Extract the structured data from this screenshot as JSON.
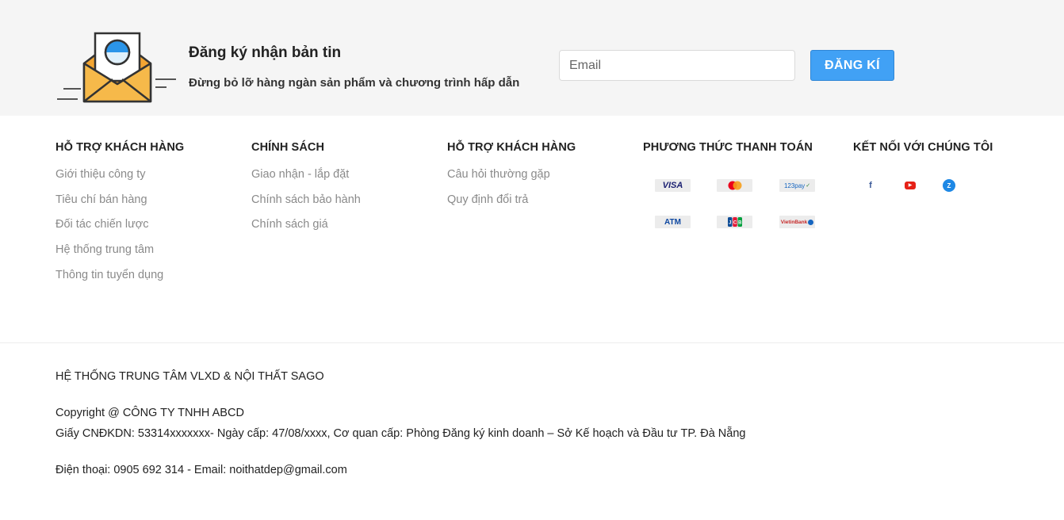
{
  "newsletter": {
    "illustration_icon": "envelope-newsletter-icon",
    "title": "Đăng ký nhận bản tin",
    "subtitle": "Đừng bỏ lỡ hàng ngàn sản phẩm và chương trình hấp dẫn",
    "email_placeholder": "Email",
    "email_value": "",
    "submit_label": "ĐĂNG KÍ",
    "accent_color": "#41a1f5"
  },
  "footer": {
    "columns": [
      {
        "title": "HỖ TRỢ KHÁCH HÀNG",
        "links": [
          "Giới thiệu công ty",
          "Tiêu chí bán hàng",
          "Đối tác chiến lược",
          "Hệ thống trung tâm",
          "Thông tin tuyển dụng"
        ]
      },
      {
        "title": "CHÍNH SÁCH",
        "links": [
          "Giao nhận - lắp đặt",
          "Chính sách bảo hành",
          "Chính sách giá"
        ]
      },
      {
        "title": "HỖ TRỢ KHÁCH HÀNG",
        "links": [
          "Câu hỏi thường gặp",
          "Quy định đổi trả"
        ]
      }
    ],
    "payment": {
      "title": "PHƯƠNG THỨC THANH TOÁN",
      "methods": [
        {
          "label": "VISA",
          "icon": "visa-icon"
        },
        {
          "label": "",
          "icon": "mastercard-icon"
        },
        {
          "label": "123pay",
          "icon": "123pay-icon"
        },
        {
          "label": "ATM",
          "icon": "atm-icon"
        },
        {
          "label": "",
          "icon": "jcb-icon"
        },
        {
          "label": "VietinBank",
          "icon": "vietinbank-icon"
        }
      ]
    },
    "connect": {
      "title": "KẾT NỐI VỚI CHÚNG TÔI",
      "items": [
        {
          "glyph": "f",
          "icon": "facebook-icon",
          "color": "#3b5998"
        },
        {
          "glyph": "▶",
          "icon": "youtube-icon",
          "color": "#e62117"
        },
        {
          "glyph": "Z",
          "icon": "zalo-icon",
          "color": "#1e88e5"
        }
      ]
    }
  },
  "legal": {
    "company_system": "HỆ THỐNG TRUNG TÂM VLXD & NỘI THẤT SAGO",
    "copyright": "Copyright @ CÔNG TY TNHH ABCD",
    "license": "Giấy CNĐKDN: 53314xxxxxxx- Ngày cấp: 47/08/xxxx, Cơ quan cấp: Phòng Đăng ký kinh doanh – Sở Kế hoạch và Đầu tư TP. Đà Nẵng",
    "contact": "Điện thoại: 0905 692 314 - Email: noithatdep@gmail.com"
  }
}
